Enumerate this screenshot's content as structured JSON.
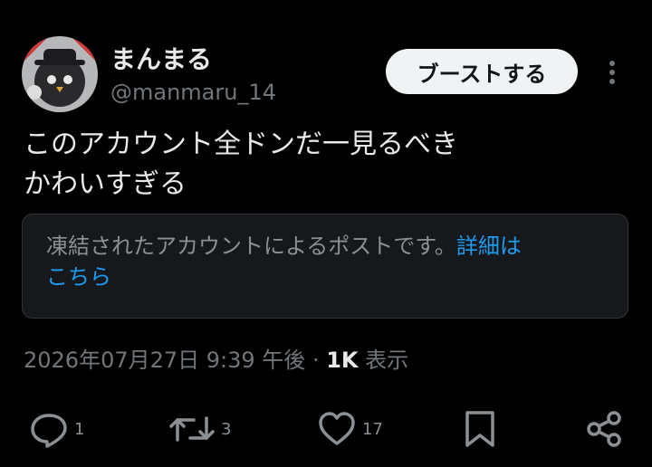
{
  "author": {
    "display_name": "まんまる",
    "handle": "@manmaru_14"
  },
  "header": {
    "boost_label": "ブーストする"
  },
  "post": {
    "lines": [
      "このアカウント全ドンだ一見るべき",
      "かわいすぎる"
    ]
  },
  "notice": {
    "text": "凍結されたアカウントによるポストです。",
    "link_label_1": "詳細は",
    "link_label_2": "こちら"
  },
  "meta": {
    "timestamp": "2026年07月27日 9:39 午後",
    "separator": "·",
    "views_count": "1K",
    "views_label": "表示"
  },
  "actions": {
    "reply_count": "1",
    "repost_count": "3",
    "like_count": "17"
  },
  "colors": {
    "background": "#000000",
    "text": "#e7e9ea",
    "muted": "#71767b",
    "link": "#1d9bf0",
    "boost_bg": "#eff3f4"
  }
}
